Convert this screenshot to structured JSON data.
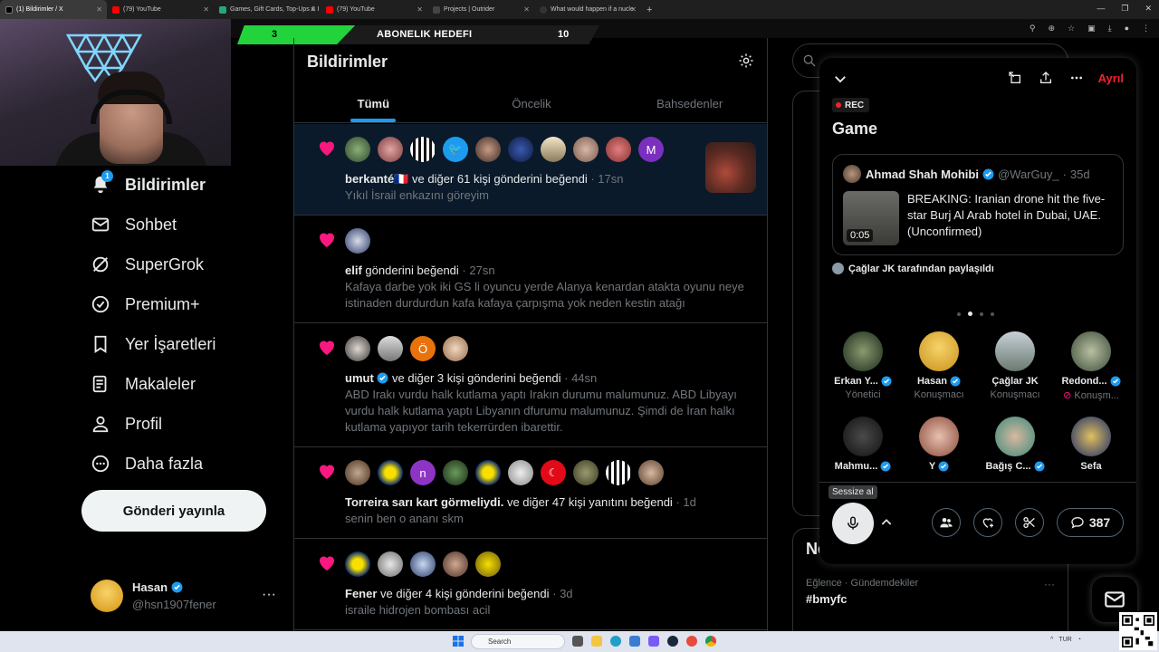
{
  "browser": {
    "tabs": [
      {
        "title": "(1) Bildirimler / X",
        "active": true
      },
      {
        "title": "(79) YouTube",
        "active": false
      },
      {
        "title": "Games, Gift Cards, Top-Ups & I",
        "active": false
      },
      {
        "title": "(79) YouTube",
        "active": false
      },
      {
        "title": "Projects | Outrider",
        "active": false
      },
      {
        "title": "What would happen if a nucle",
        "active": false
      }
    ]
  },
  "overlay": {
    "goal_current": "3",
    "goal_label": "ABONELIK HEDEFI",
    "goal_target": "10"
  },
  "nav": {
    "notification_badge": "1",
    "items": [
      {
        "label": "Bildirimler",
        "icon": "bell-icon"
      },
      {
        "label": "Sohbet",
        "icon": "mail-icon"
      },
      {
        "label": "SuperGrok",
        "icon": "grok-icon"
      },
      {
        "label": "Premium+",
        "icon": "verified-icon"
      },
      {
        "label": "Yer İşaretleri",
        "icon": "bookmark-icon"
      },
      {
        "label": "Makaleler",
        "icon": "article-icon"
      },
      {
        "label": "Profil",
        "icon": "person-icon"
      },
      {
        "label": "Daha fazla",
        "icon": "more-circle-icon"
      }
    ],
    "post_button": "Gönderi yayınla",
    "account_name": "Hasan",
    "account_handle": "@hsn1907fener"
  },
  "main": {
    "title": "Bildirimler",
    "tabs": [
      "Tümü",
      "Öncelik",
      "Bahsedenler"
    ],
    "notifications": [
      {
        "actor": "berkanté",
        "flag": "🇫🇷",
        "action": "ve diğer 61 kişi gönderini beğendi",
        "time": "17sn",
        "text": "Yıkıl İsrail enkazını göreyim",
        "avatar_letter": "M"
      },
      {
        "actor": "elif",
        "action": "gönderini beğendi",
        "time": "27sn",
        "text": "Kafaya darbe yok iki GS li oyuncu yerde Alanya kenardan atakta oyunu neye istinaden durdurdun kafa kafaya çarpışma yok neden kestin atağı"
      },
      {
        "actor": "umut",
        "action": "ve diğer 3 kişi gönderini beğendi",
        "time": "44sn",
        "text": "ABD Irakı vurdu halk kutlama yaptı Irakın durumu malumunuz. ABD Libyayı vurdu halk kutlama yaptı Libyanın dfurumu malumunuz. Şimdi de İran halkı kutlama yapıyor tarih tekerrürden ibarettir.",
        "avatar_letter": "Ö"
      },
      {
        "actor": "Torreira sarı kart görmeliydi.",
        "action": "ve diğer 47 kişi yanıtını beğendi",
        "time": "1d",
        "text": "senin ben o ananı skm",
        "avatar_letter": "n"
      },
      {
        "actor": "Fener",
        "action": "ve diğer 4 kişi gönderini beğendi",
        "time": "3d",
        "text": "israile hidrojen bombası acil"
      }
    ]
  },
  "right": {
    "trend_box2_title": "Ne",
    "trend_category": "Eğlence · Gündemdekiler",
    "trend_tag": "#bmyfc"
  },
  "space": {
    "leave_label": "Ayrıl",
    "rec_label": "REC",
    "title": "Game",
    "pinned": {
      "name": "Ahmad Shah Mohibi",
      "handle": "@WarGuy_",
      "age": "35d",
      "duration": "0:05",
      "text": "BREAKING: Iranian drone hit the five-star Burj Al Arab hotel in Dubai, UAE. (Unconfirmed)"
    },
    "shared_by": "Çağlar JK tarafından paylaşıldı",
    "speakers": [
      {
        "name": "Erkan Y...",
        "role": "Yönetici",
        "verified": true
      },
      {
        "name": "Hasan",
        "role": "Konuşmacı",
        "verified": true
      },
      {
        "name": "Çağlar JK",
        "role": "Konuşmacı",
        "verified": false
      },
      {
        "name": "Redond...",
        "role": "Konuşm...",
        "verified": true
      },
      {
        "name": "Mahmu...",
        "role": "",
        "verified": true
      },
      {
        "name": "Y",
        "role": "",
        "verified": true
      },
      {
        "name": "Bağış C...",
        "role": "",
        "verified": true
      },
      {
        "name": "Sefa",
        "role": "",
        "verified": false
      }
    ],
    "mute_tooltip": "Sessize al",
    "comment_count": "387"
  },
  "taskbar": {
    "search_placeholder": "Search",
    "tray_lang": "TUR"
  },
  "colors": {
    "accent_blue": "#1d9bf0",
    "like_pink": "#f91880",
    "leave_red": "#f4212e",
    "goal_green": "#22d33b"
  }
}
